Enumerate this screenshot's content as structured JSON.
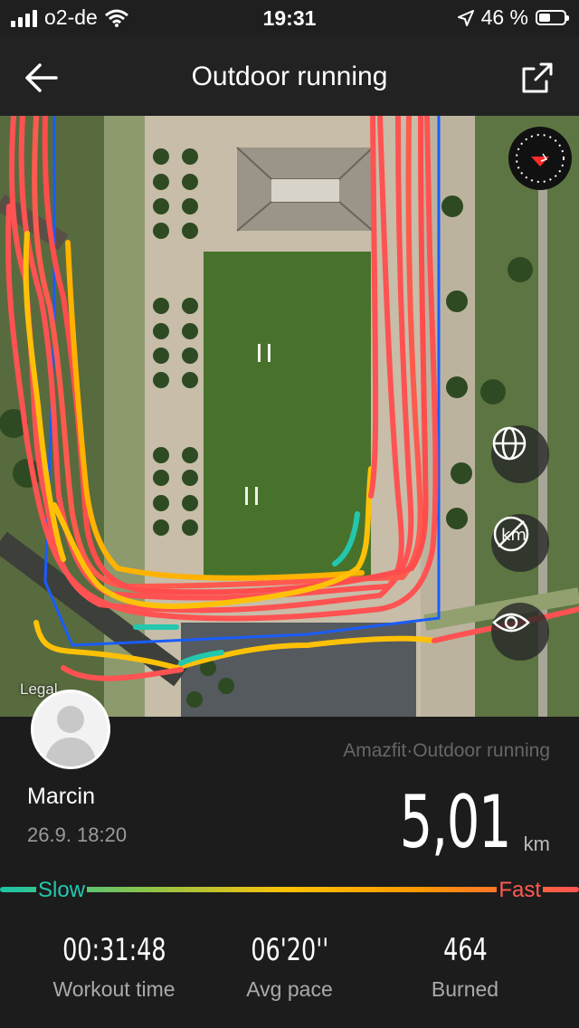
{
  "status_bar": {
    "carrier": "o2-de",
    "time": "19:31",
    "battery": "46 %"
  },
  "header": {
    "title": "Outdoor running"
  },
  "map": {
    "legal": "Legal"
  },
  "summary": {
    "device": "Amazfit·Outdoor running",
    "user": "Marcin",
    "datetime": "26.9. 18:20",
    "distance": "5,01",
    "distance_unit": "km",
    "pace_scale": {
      "slow": "Slow",
      "fast": "Fast"
    },
    "stats": [
      {
        "value": "00:31:48",
        "label": "Workout time"
      },
      {
        "value": "06'20''",
        "label": "Avg pace"
      },
      {
        "value": "464",
        "label": "Burned"
      }
    ]
  },
  "colors": {
    "slow": "#19c3a8",
    "medium": "#ffc107",
    "fast": "#ff5252",
    "route_outline": "#1a5cff"
  },
  "icons": [
    "back-arrow-icon",
    "share-icon",
    "compass-icon",
    "globe-icon",
    "km-hidden-icon",
    "eye-icon",
    "avatar-icon"
  ]
}
